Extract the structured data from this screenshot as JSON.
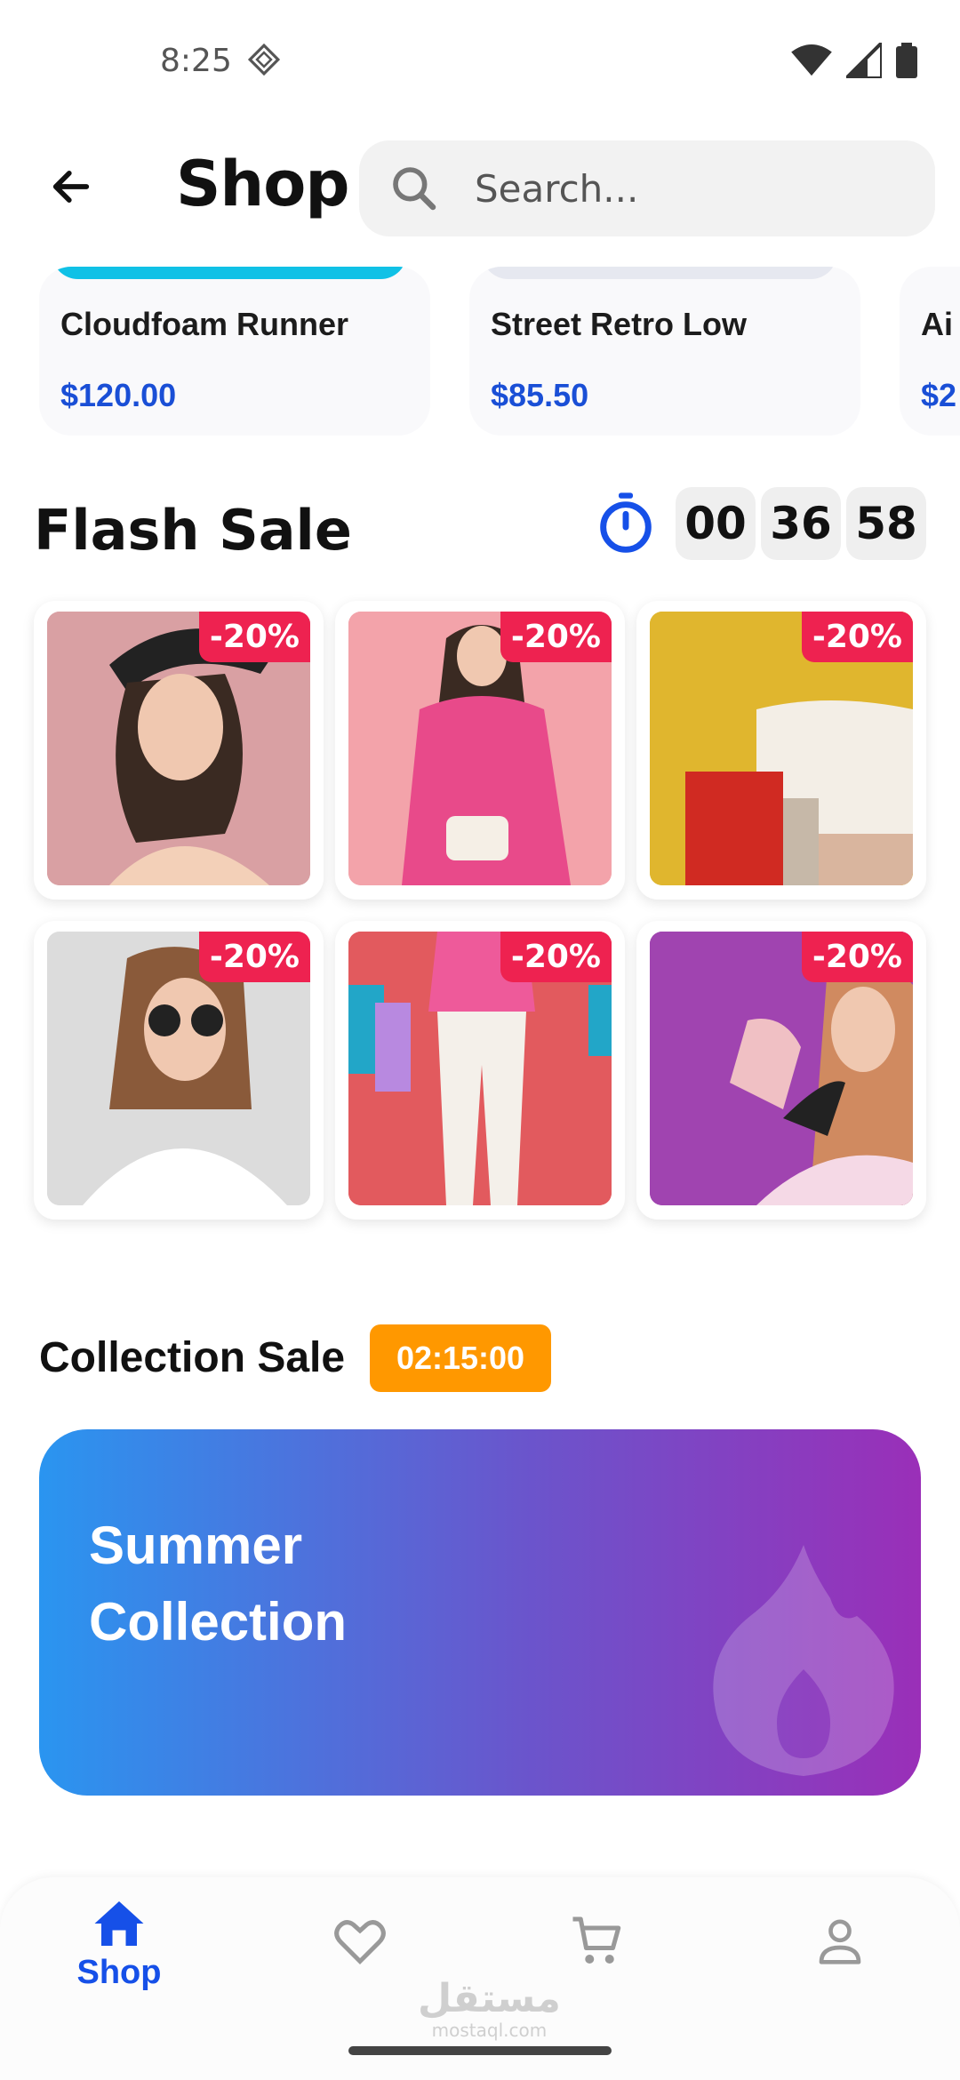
{
  "status_bar": {
    "time": "8:25"
  },
  "header": {
    "title": "Shop",
    "search_placeholder": "Search..."
  },
  "products": [
    {
      "name": "Cloudfoam Runner",
      "price": "$120.00"
    },
    {
      "name": "Street Retro Low",
      "price": "$85.50"
    },
    {
      "name": "Ai",
      "price": "$2"
    }
  ],
  "flash_sale": {
    "title": "Flash Sale",
    "timer": {
      "hours": "00",
      "minutes": "36",
      "seconds": "58"
    },
    "items": [
      {
        "discount": "-20%"
      },
      {
        "discount": "-20%"
      },
      {
        "discount": "-20%"
      },
      {
        "discount": "-20%"
      },
      {
        "discount": "-20%"
      },
      {
        "discount": "-20%"
      }
    ]
  },
  "collection_sale": {
    "title": "Collection Sale",
    "timer": "02:15:00",
    "banner_title": "Summer Collection"
  },
  "bottom_nav": {
    "items": [
      {
        "label": "Shop"
      }
    ]
  },
  "watermark": {
    "arabic": "مستقل",
    "latin": "mostaql.com"
  },
  "colors": {
    "accent": "#1650e8",
    "price": "#1a4fd6",
    "badge": "#ee2250",
    "collection_timer": "#ff9800",
    "banner_start": "#2a95f0",
    "banner_end": "#9a2fb8"
  }
}
